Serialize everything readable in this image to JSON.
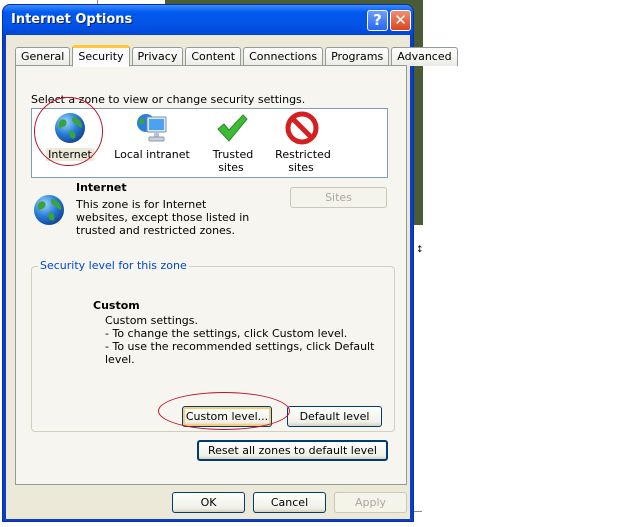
{
  "window": {
    "title": "Internet Options",
    "help_button": "?",
    "close_button": "✕"
  },
  "tabs": [
    {
      "label": "General",
      "active": false
    },
    {
      "label": "Security",
      "active": true
    },
    {
      "label": "Privacy",
      "active": false
    },
    {
      "label": "Content",
      "active": false
    },
    {
      "label": "Connections",
      "active": false
    },
    {
      "label": "Programs",
      "active": false
    },
    {
      "label": "Advanced",
      "active": false
    }
  ],
  "security": {
    "prompt": "Select a zone to view or change security settings.",
    "zones": [
      {
        "label": "Internet",
        "icon": "globe-icon",
        "selected": true
      },
      {
        "label": "Local intranet",
        "icon": "intranet-icon",
        "selected": false
      },
      {
        "label": "Trusted sites",
        "icon": "checkmark-icon",
        "selected": false
      },
      {
        "label": "Restricted sites",
        "label_line1": "Restricted",
        "label_line2": "sites",
        "icon": "restricted-icon",
        "selected": false
      }
    ],
    "selected_zone": {
      "name": "Internet",
      "description": "This zone is for Internet websites, except those listed in trusted and restricted zones.",
      "sites_button": "Sites",
      "sites_enabled": false
    },
    "level_group_title": "Security level for this zone",
    "level": {
      "name": "Custom",
      "lines": [
        "Custom settings.",
        "- To change the settings, click Custom level.",
        "- To use the recommended settings, click Default level."
      ]
    },
    "custom_level_button": "Custom level...",
    "default_level_button": "Default level",
    "reset_button": "Reset all zones to default level"
  },
  "footer": {
    "ok": "OK",
    "cancel": "Cancel",
    "apply": "Apply",
    "apply_enabled": false
  },
  "annotations": {
    "color": "#c0102a"
  }
}
